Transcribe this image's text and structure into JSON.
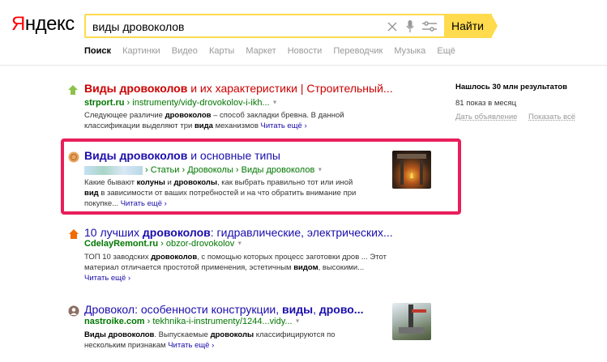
{
  "logo": {
    "first": "Я",
    "rest": "ндекс"
  },
  "search": {
    "value": "виды дровоколов",
    "button": "Найти"
  },
  "tabs": [
    "Поиск",
    "Картинки",
    "Видео",
    "Карты",
    "Маркет",
    "Новости",
    "Переводчик",
    "Музыка",
    "Ещё"
  ],
  "sidebar": {
    "found": "Нашлось 30 млн результатов",
    "shows": "81 показ в месяц",
    "ad": "Дать объявление",
    "show_all": "Показать всё"
  },
  "colors": {
    "accent": "#ffdb4d",
    "highlight": "#e91e5a",
    "link": "#1a0dab",
    "url": "#007700"
  },
  "results": [
    {
      "title_bold": "Виды дровоколов",
      "title_rest": " и их характеристики | Строительный...",
      "domain": "strport.ru",
      "path": " › instrumenty/vidy-drovokolov-i-ikh...",
      "snippet_1a": "Следующее различие ",
      "snippet_1b": "дровоколов",
      "snippet_1c": " – способ закладки бревна. В данной",
      "snippet_2a": "классификации выделяют три ",
      "snippet_2b": "вида",
      "snippet_2c": " механизмов",
      "more": "Читать ещё ›"
    },
    {
      "title_bold": "Виды дровоколов",
      "title_rest": " и основные типы",
      "path": " › Статьи › Дровоколы › Виды дровоколов",
      "snippet_1a": "Какие бывают ",
      "snippet_1b": "колуны",
      "snippet_1c": " и ",
      "snippet_1d": "дровоколы",
      "snippet_1e": ", как выбрать правильно тот или иной",
      "snippet_2a": "вид",
      "snippet_2b": " в зависимости от ваших потребностей и на что обратить внимание при",
      "snippet_3": "покупке...",
      "more": "Читать ещё ›"
    },
    {
      "title_a": "10 лучших ",
      "title_b": "дровоколов",
      "title_c": ": гидравлические, электрических...",
      "domain": "CdelayRemont.ru",
      "path": " › obzor-drovokolov",
      "snippet_1a": "ТОП 10 заводских ",
      "snippet_1b": "дровоколов",
      "snippet_1c": ", с помощью которых процесс заготовки дров ... Этот",
      "snippet_2a": "материал отличается простотой применения, эстетичным ",
      "snippet_2b": "видом",
      "snippet_2c": ", высокими...",
      "more": "Читать ещё ›"
    },
    {
      "title_a": "Дровокол",
      "title_b": ": особенности конструкции, ",
      "title_c": "виды",
      "title_d": ", ",
      "title_e": "дрово...",
      "domain": "nastroike.com",
      "path": " › tekhnika-i-instrumenty/1244...vidy...",
      "snippet_1a": "Виды дровоколов",
      "snippet_1b": ". Выпускаемые ",
      "snippet_1c": "дровоколы",
      "snippet_1d": " классифицируются по",
      "snippet_2a": "нескольким признакам",
      "more": "Читать ещё ›"
    }
  ]
}
